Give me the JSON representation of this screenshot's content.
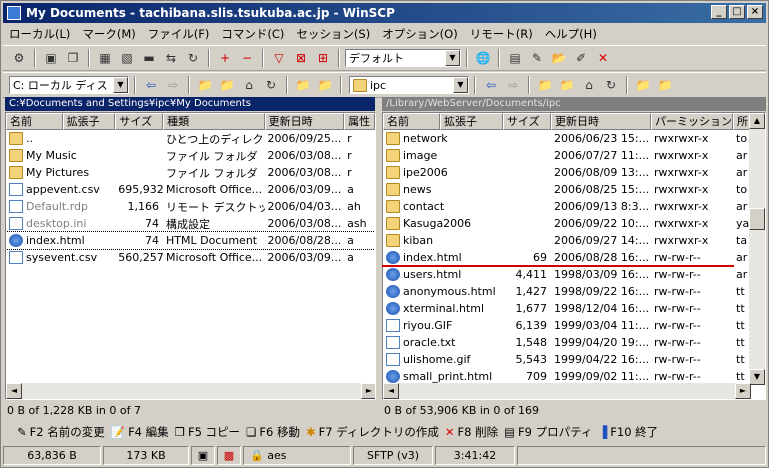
{
  "window": {
    "title": "My Documents - tachibana.slis.tsukuba.ac.jp - WinSCP"
  },
  "menu": [
    "ローカル(L)",
    "マーク(M)",
    "ファイル(F)",
    "コマンド(C)",
    "セッション(S)",
    "オプション(O)",
    "リモート(R)",
    "ヘルプ(H)"
  ],
  "toolbar": {
    "preset": "デフォルト"
  },
  "local": {
    "drive": "C: ローカル ディス",
    "path": "C:¥Documents and Settings¥ipc¥My Documents",
    "columns": [
      "名前",
      "拡張子",
      "サイズ",
      "種類",
      "更新日時",
      "属性"
    ],
    "rows": [
      {
        "name": "..",
        "size": "",
        "type": "ひとつ上のディレクト...",
        "date": "2006/09/25...",
        "attr": "r",
        "icon": "updir"
      },
      {
        "name": "My Music",
        "size": "",
        "type": "ファイル フォルダ",
        "date": "2006/03/08...",
        "attr": "r",
        "icon": "folder"
      },
      {
        "name": "My Pictures",
        "size": "",
        "type": "ファイル フォルダ",
        "date": "2006/03/08...",
        "attr": "r",
        "icon": "folder"
      },
      {
        "name": "appevent.csv",
        "size": "695,932",
        "type": "Microsoft Office...",
        "date": "2006/03/09...",
        "attr": "a",
        "icon": "file"
      },
      {
        "name": "Default.rdp",
        "size": "1,166",
        "type": "リモート デスクトッ...",
        "date": "2006/04/03...",
        "attr": "ah",
        "icon": "file"
      },
      {
        "name": "desktop.ini",
        "size": "74",
        "type": "構成設定",
        "date": "2006/03/08...",
        "attr": "ash",
        "icon": "file"
      },
      {
        "name": "index.html",
        "size": "74",
        "type": "HTML Document",
        "date": "2006/08/28...",
        "attr": "a",
        "icon": "ie"
      },
      {
        "name": "sysevent.csv",
        "size": "560,257",
        "type": "Microsoft Office...",
        "date": "2006/03/09...",
        "attr": "a",
        "icon": "file"
      }
    ],
    "status": "0 B of 1,228 KB in 0 of 7"
  },
  "remote": {
    "folder": "ipc",
    "path": "/Library/WebServer/Documents/ipc",
    "columns": [
      "名前",
      "拡張子",
      "サイズ",
      "更新日時",
      "パーミッション",
      "所"
    ],
    "rows": [
      {
        "name": "network",
        "size": "",
        "date": "2006/06/23 15:...",
        "perm": "rwxrwxr-x",
        "owner": "to",
        "icon": "folder"
      },
      {
        "name": "image",
        "size": "",
        "date": "2006/07/27 11:...",
        "perm": "rwxrwxr-x",
        "owner": "ar",
        "icon": "folder"
      },
      {
        "name": "ipe2006",
        "size": "",
        "date": "2006/08/09 13:...",
        "perm": "rwxrwxr-x",
        "owner": "ar",
        "icon": "folder"
      },
      {
        "name": "news",
        "size": "",
        "date": "2006/08/25 15:...",
        "perm": "rwxrwxr-x",
        "owner": "to",
        "icon": "folder"
      },
      {
        "name": "contact",
        "size": "",
        "date": "2006/09/13 8:3...",
        "perm": "rwxrwxr-x",
        "owner": "ar",
        "icon": "folder"
      },
      {
        "name": "Kasuga2006",
        "size": "",
        "date": "2006/09/22 10:...",
        "perm": "rwxrwxr-x",
        "owner": "ya",
        "icon": "folder"
      },
      {
        "name": "kiban",
        "size": "",
        "date": "2006/09/27 14:...",
        "perm": "rwxrwxr-x",
        "owner": "ta",
        "icon": "folder"
      },
      {
        "name": "index.html",
        "size": "69",
        "date": "2006/08/28 16:...",
        "perm": "rw-rw-r--",
        "owner": "ar",
        "icon": "ie"
      },
      {
        "name": "users.html",
        "size": "4,411",
        "date": "1998/03/09 16:...",
        "perm": "rw-rw-r--",
        "owner": "ar",
        "icon": "ie"
      },
      {
        "name": "anonymous.html",
        "size": "1,427",
        "date": "1998/09/22 16:...",
        "perm": "rw-rw-r--",
        "owner": "tt",
        "icon": "ie"
      },
      {
        "name": "xterminal.html",
        "size": "1,677",
        "date": "1998/12/04 16:...",
        "perm": "rw-rw-r--",
        "owner": "tt",
        "icon": "ie"
      },
      {
        "name": "riyou.GIF",
        "size": "6,139",
        "date": "1999/03/04 11:...",
        "perm": "rw-rw-r--",
        "owner": "tt",
        "icon": "img"
      },
      {
        "name": "oracle.txt",
        "size": "1,548",
        "date": "1999/04/20 19:...",
        "perm": "rw-rw-r--",
        "owner": "tt",
        "icon": "file"
      },
      {
        "name": "ulishome.gif",
        "size": "5,543",
        "date": "1999/04/22 16:...",
        "perm": "rw-rw-r--",
        "owner": "tt",
        "icon": "img"
      },
      {
        "name": "small_print.html",
        "size": "709",
        "date": "1999/09/02 11:...",
        "perm": "rw-rw-r--",
        "owner": "tt",
        "icon": "ie"
      }
    ],
    "status": "0 B of 53,906 KB in 0 of 169"
  },
  "fkeys": [
    "F2 名前の変更",
    "F4 編集",
    "F5 コピー",
    "F6 移動",
    "F7 ディレクトリの作成",
    "F8 削除",
    "F9 プロパティ",
    "F10 終了"
  ],
  "statusbar": {
    "sent": "63,836 B",
    "recv": "173 KB",
    "cipher": "aes",
    "protocol": "SFTP (v3)",
    "time": "3:41:42"
  }
}
